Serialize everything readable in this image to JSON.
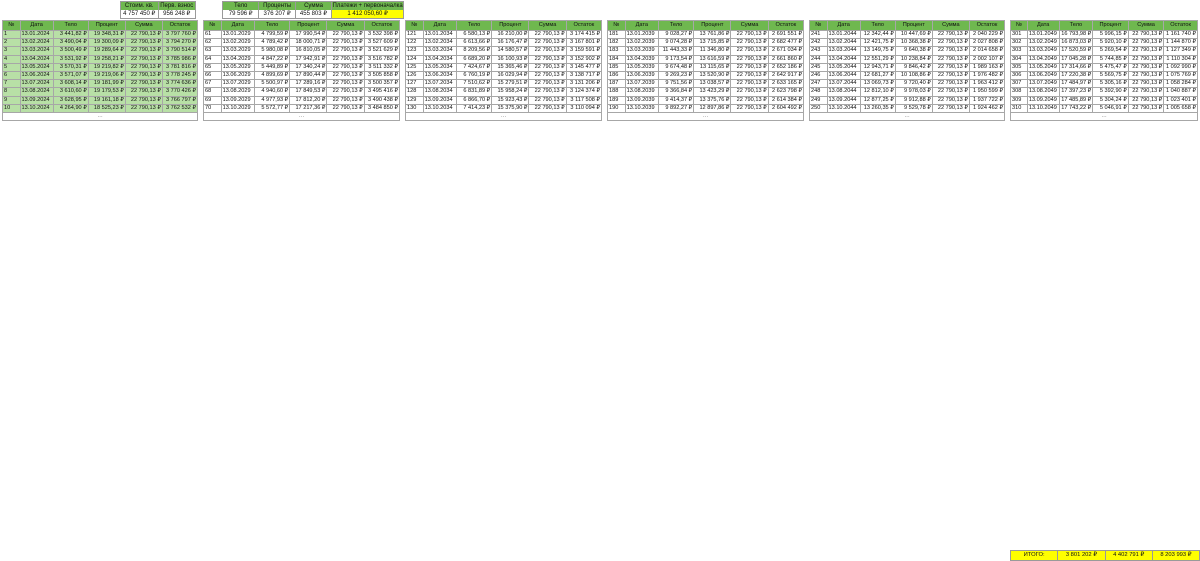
{
  "summary": {
    "headers": [
      "Стоим. кв.",
      "Перв. взнос"
    ],
    "values": [
      "4 757 450 ₽",
      "956 248 ₽"
    ]
  },
  "summary2": {
    "headers": [
      "Тело",
      "Проценты",
      "Сумма",
      "Платежи + первоначалка"
    ],
    "values": [
      "79 596 ₽",
      "376 207 ₽",
      "455 803 ₽",
      "1 412 050,60 ₽"
    ]
  },
  "columns": [
    "№",
    "Дата",
    "Тело",
    "Процент",
    "Сумма",
    "Остаток"
  ],
  "colors": {
    "paid": "#b8e0a6",
    "upcoming": "#f1c7a8",
    "header": "#6fb84f",
    "totals": "#ffff00"
  },
  "blocks": [
    {
      "rows": [
        [
          "1",
          "13.01.2024",
          "3 441,82 ₽",
          "19 348,31 ₽",
          "22 790,13 ₽",
          "3 797 760 ₽",
          "g"
        ],
        [
          "2",
          "13.02.2024",
          "3 490,04 ₽",
          "19 300,09 ₽",
          "22 790,13 ₽",
          "3 794 270 ₽",
          "g"
        ],
        [
          "3",
          "13.03.2024",
          "3 500,49 ₽",
          "19 289,64 ₽",
          "22 790,13 ₽",
          "3 790 514 ₽",
          "g"
        ],
        [
          "4",
          "13.04.2024",
          "3 531,92 ₽",
          "19 258,21 ₽",
          "22 790,13 ₽",
          "3 785 986 ₽",
          "g"
        ],
        [
          "5",
          "13.05.2024",
          "3 570,31 ₽",
          "19 219,82 ₽",
          "22 790,13 ₽",
          "3 781 816 ₽",
          "g"
        ],
        [
          "6",
          "13.06.2024",
          "3 571,07 ₽",
          "19 219,06 ₽",
          "22 790,13 ₽",
          "3 778 245 ₽",
          "g"
        ],
        [
          "7",
          "13.07.2024",
          "3 608,14 ₽",
          "19 181,99 ₽",
          "22 790,13 ₽",
          "3 774 636 ₽",
          "g"
        ],
        [
          "8",
          "13.08.2024",
          "3 610,60 ₽",
          "19 179,53 ₽",
          "22 790,13 ₽",
          "3 770 426 ₽",
          "g"
        ],
        [
          "9",
          "13.09.2024",
          "3 628,95 ₽",
          "19 161,18 ₽",
          "22 790,13 ₽",
          "3 766 797 ₽",
          "g"
        ],
        [
          "10",
          "13.10.2024",
          "4 264,90 ₽",
          "18 525,23 ₽",
          "22 790,13 ₽",
          "3 762 532 ₽",
          "g"
        ]
      ]
    },
    {
      "rows": [
        [
          "61",
          "13.01.2029",
          "4 799,59 ₽",
          "17 990,54 ₽",
          "22 790,13 ₽",
          "3 532 398 ₽",
          "w"
        ],
        [
          "62",
          "13.02.2029",
          "4 789,42 ₽",
          "18 000,71 ₽",
          "22 790,13 ₽",
          "3 527 609 ₽",
          "w"
        ],
        [
          "63",
          "13.03.2029",
          "5 980,08 ₽",
          "16 810,05 ₽",
          "22 790,13 ₽",
          "3 521 629 ₽",
          "w"
        ],
        [
          "64",
          "13.04.2029",
          "4 847,22 ₽",
          "17 942,91 ₽",
          "22 790,13 ₽",
          "3 516 782 ₽",
          "w"
        ],
        [
          "65",
          "13.05.2029",
          "5 449,89 ₽",
          "17 340,24 ₽",
          "22 790,13 ₽",
          "3 511 332 ₽",
          "w"
        ],
        [
          "66",
          "13.06.2029",
          "4 899,69 ₽",
          "17 890,44 ₽",
          "22 790,13 ₽",
          "3 505 858 ₽",
          "w"
        ],
        [
          "67",
          "13.07.2029",
          "5 500,97 ₽",
          "17 289,16 ₽",
          "22 790,13 ₽",
          "3 500 357 ₽",
          "w"
        ],
        [
          "68",
          "13.08.2029",
          "4 940,60 ₽",
          "17 849,53 ₽",
          "22 790,13 ₽",
          "3 495 416 ₽",
          "w"
        ],
        [
          "69",
          "13.09.2029",
          "4 977,93 ₽",
          "17 812,20 ₽",
          "22 790,13 ₽",
          "3 490 438 ₽",
          "w"
        ],
        [
          "70",
          "13.10.2029",
          "5 572,77 ₽",
          "17 217,36 ₽",
          "22 790,13 ₽",
          "3 484 850 ₽",
          "w"
        ]
      ]
    },
    {
      "rows": [
        [
          "121",
          "13.01.2034",
          "6 580,13 ₽",
          "16 210,00 ₽",
          "22 790,13 ₽",
          "3 174 415 ₽",
          "w"
        ],
        [
          "122",
          "13.02.2034",
          "6 613,66 ₽",
          "16 176,47 ₽",
          "22 790,13 ₽",
          "3 167 801 ₽",
          "w"
        ],
        [
          "123",
          "13.03.2034",
          "8 209,56 ₽",
          "14 580,57 ₽",
          "22 790,13 ₽",
          "3 159 591 ₽",
          "w"
        ],
        [
          "124",
          "13.04.2034",
          "6 689,20 ₽",
          "16 100,93 ₽",
          "22 790,13 ₽",
          "3 152 902 ₽",
          "w"
        ],
        [
          "125",
          "13.05.2034",
          "7 424,67 ₽",
          "15 365,46 ₽",
          "22 790,13 ₽",
          "3 145 477 ₽",
          "w"
        ],
        [
          "126",
          "13.06.2034",
          "6 760,19 ₽",
          "16 029,94 ₽",
          "22 790,13 ₽",
          "3 138 717 ₽",
          "w"
        ],
        [
          "127",
          "13.07.2034",
          "7 510,62 ₽",
          "15 279,51 ₽",
          "22 790,13 ₽",
          "3 131 206 ₽",
          "w"
        ],
        [
          "128",
          "13.08.2034",
          "6 831,89 ₽",
          "15 958,24 ₽",
          "22 790,13 ₽",
          "3 124 374 ₽",
          "w"
        ],
        [
          "129",
          "13.09.2034",
          "6 866,70 ₽",
          "15 923,43 ₽",
          "22 790,13 ₽",
          "3 117 508 ₽",
          "w"
        ],
        [
          "130",
          "13.10.2034",
          "7 414,23 ₽",
          "15 375,90 ₽",
          "22 790,13 ₽",
          "3 110 094 ₽",
          "w"
        ]
      ]
    },
    {
      "rows": [
        [
          "181",
          "13.01.2039",
          "9 028,27 ₽",
          "13 761,86 ₽",
          "22 790,13 ₽",
          "2 691 551 ₽",
          "w"
        ],
        [
          "182",
          "13.02.2039",
          "9 074,28 ₽",
          "13 715,85 ₽",
          "22 790,13 ₽",
          "2 682 477 ₽",
          "w"
        ],
        [
          "183",
          "13.03.2039",
          "11 443,33 ₽",
          "11 346,80 ₽",
          "22 790,13 ₽",
          "2 671 034 ₽",
          "w"
        ],
        [
          "184",
          "13.04.2039",
          "9 173,54 ₽",
          "13 616,59 ₽",
          "22 790,13 ₽",
          "2 661 860 ₽",
          "w"
        ],
        [
          "185",
          "13.05.2039",
          "9 674,48 ₽",
          "13 115,65 ₽",
          "22 790,13 ₽",
          "2 652 186 ₽",
          "w"
        ],
        [
          "186",
          "13.06.2039",
          "9 269,23 ₽",
          "13 520,90 ₽",
          "22 790,13 ₽",
          "2 642 917 ₽",
          "w"
        ],
        [
          "187",
          "13.07.2039",
          "9 751,56 ₽",
          "13 038,57 ₽",
          "22 790,13 ₽",
          "2 633 165 ₽",
          "w"
        ],
        [
          "188",
          "13.08.2039",
          "9 366,84 ₽",
          "13 423,29 ₽",
          "22 790,13 ₽",
          "2 623 798 ₽",
          "w"
        ],
        [
          "189",
          "13.09.2039",
          "9 414,37 ₽",
          "13 375,76 ₽",
          "22 790,13 ₽",
          "2 614 384 ₽",
          "w"
        ],
        [
          "190",
          "13.10.2039",
          "9 892,27 ₽",
          "12 897,86 ₽",
          "22 790,13 ₽",
          "2 604 492 ₽",
          "w"
        ]
      ]
    },
    {
      "rows": [
        [
          "241",
          "13.01.2044",
          "12 342,44 ₽",
          "10 447,69 ₽",
          "22 790,13 ₽",
          "2 040 229 ₽",
          "w"
        ],
        [
          "242",
          "13.02.2044",
          "12 421,75 ₽",
          "10 368,38 ₽",
          "22 790,13 ₽",
          "2 027 808 ₽",
          "w"
        ],
        [
          "243",
          "13.03.2044",
          "13 149,75 ₽",
          "9 640,38 ₽",
          "22 790,13 ₽",
          "2 014 658 ₽",
          "w"
        ],
        [
          "244",
          "13.04.2044",
          "12 551,29 ₽",
          "10 238,84 ₽",
          "22 790,13 ₽",
          "2 002 107 ₽",
          "w"
        ],
        [
          "245",
          "13.05.2044",
          "12 943,71 ₽",
          "9 846,42 ₽",
          "22 790,13 ₽",
          "1 989 163 ₽",
          "w"
        ],
        [
          "246",
          "13.06.2044",
          "12 681,27 ₽",
          "10 108,86 ₽",
          "22 790,13 ₽",
          "1 976 482 ₽",
          "w"
        ],
        [
          "247",
          "13.07.2044",
          "13 069,73 ₽",
          "9 720,40 ₽",
          "22 790,13 ₽",
          "1 963 412 ₽",
          "w"
        ],
        [
          "248",
          "13.08.2044",
          "12 812,10 ₽",
          "9 978,03 ₽",
          "22 790,13 ₽",
          "1 950 599 ₽",
          "w"
        ],
        [
          "249",
          "13.09.2044",
          "12 877,25 ₽",
          "9 912,88 ₽",
          "22 790,13 ₽",
          "1 937 722 ₽",
          "w"
        ],
        [
          "250",
          "13.10.2044",
          "13 260,35 ₽",
          "9 529,78 ₽",
          "22 790,13 ₽",
          "1 924 462 ₽",
          "w"
        ]
      ]
    },
    {
      "rows": [
        [
          "301",
          "13.01.2049",
          "16 793,98 ₽",
          "5 996,15 ₽",
          "22 790,13 ₽",
          "1 161 740 ₽",
          "w"
        ],
        [
          "302",
          "13.02.2049",
          "16 873,03 ₽",
          "5 920,10 ₽",
          "22 790,13 ₽",
          "1 144 870 ₽",
          "w"
        ],
        [
          "303",
          "13.03.2049",
          "17 520,59 ₽",
          "5 269,54 ₽",
          "22 790,13 ₽",
          "1 127 349 ₽",
          "w"
        ],
        [
          "304",
          "13.04.2049",
          "17 045,28 ₽",
          "5 744,85 ₽",
          "22 790,13 ₽",
          "1 110 304 ₽",
          "w"
        ],
        [
          "305",
          "13.05.2049",
          "17 314,66 ₽",
          "5 475,47 ₽",
          "22 790,13 ₽",
          "1 092 990 ₽",
          "w"
        ],
        [
          "306",
          "13.06.2049",
          "17 220,38 ₽",
          "5 569,75 ₽",
          "22 790,13 ₽",
          "1 075 769 ₽",
          "w"
        ],
        [
          "307",
          "13.07.2049",
          "17 484,97 ₽",
          "5 305,16 ₽",
          "22 790,13 ₽",
          "1 058 284 ₽",
          "w"
        ],
        [
          "308",
          "13.08.2049",
          "17 397,23 ₽",
          "5 392,90 ₽",
          "22 790,13 ₽",
          "1 040 887 ₽",
          "w"
        ],
        [
          "309",
          "13.09.2049",
          "17 485,89 ₽",
          "5 304,24 ₽",
          "22 790,13 ₽",
          "1 023 401 ₽",
          "w"
        ],
        [
          "310",
          "13.10.2049",
          "17 743,22 ₽",
          "5 046,91 ₽",
          "22 790,13 ₽",
          "1 005 658 ₽",
          "w"
        ]
      ]
    }
  ],
  "ellipsis": "…",
  "totals": {
    "label": "ИТОГО:",
    "body": "3 801 202 ₽",
    "interest": "4 402 791 ₽",
    "sum": "8 203 993 ₽"
  }
}
